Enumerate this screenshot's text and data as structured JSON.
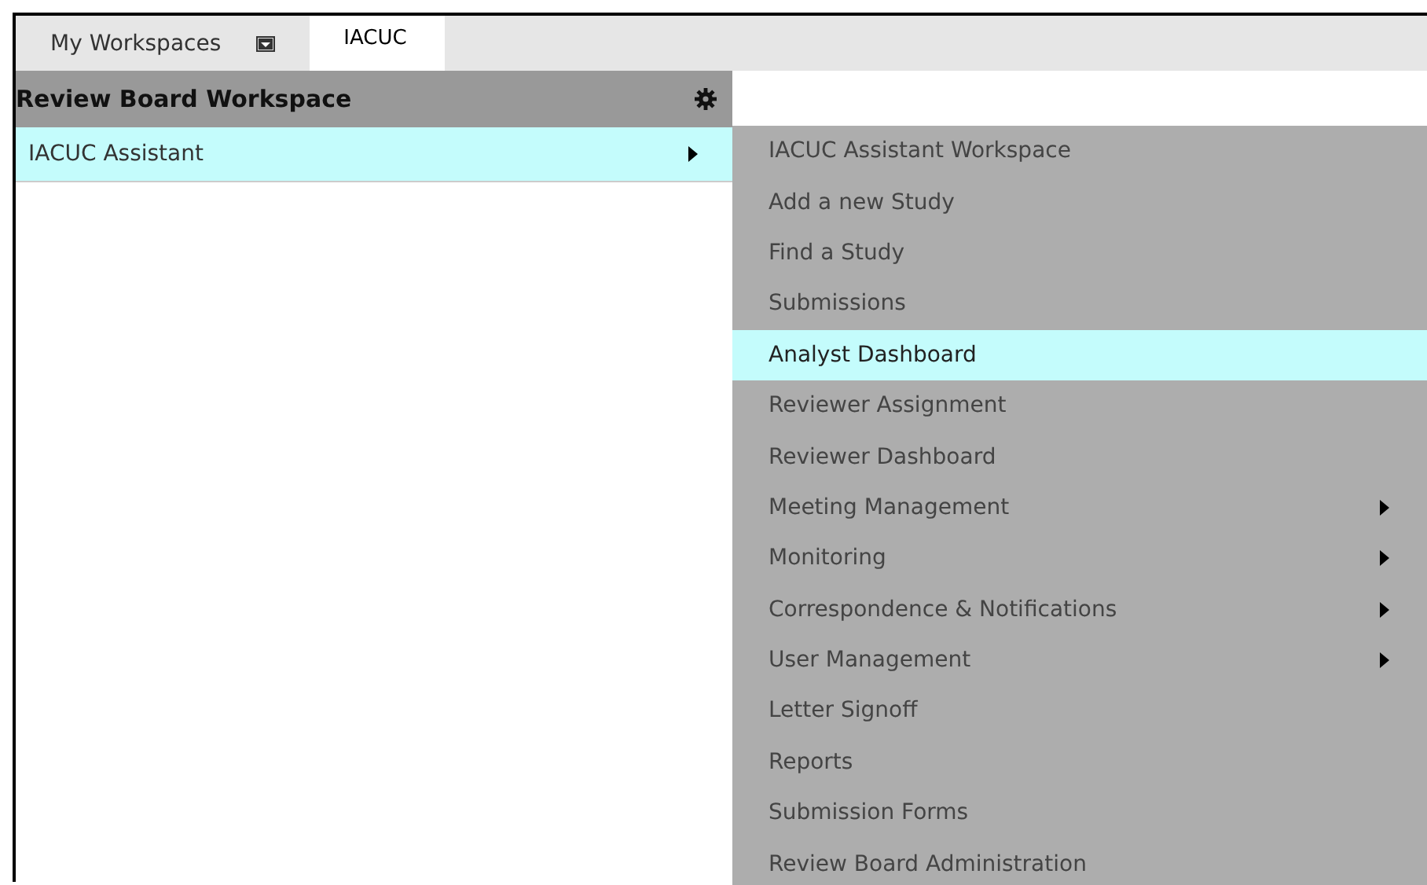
{
  "tabs": [
    {
      "label": "My Workspaces",
      "selected": false,
      "has_dropdown": true
    },
    {
      "label": "IACUC",
      "selected": true,
      "has_dropdown": false
    }
  ],
  "workspace": {
    "title": "Review Board Workspace",
    "items": [
      {
        "label": "IACUC Assistant",
        "selected": true,
        "submenu": true
      }
    ]
  },
  "submenu": {
    "items": [
      {
        "label": "IACUC Assistant Workspace",
        "selected": false,
        "submenu": false
      },
      {
        "label": "Add a new Study",
        "selected": false,
        "submenu": false
      },
      {
        "label": "Find a Study",
        "selected": false,
        "submenu": false
      },
      {
        "label": "Submissions",
        "selected": false,
        "submenu": false
      },
      {
        "label": "Analyst Dashboard",
        "selected": true,
        "submenu": false
      },
      {
        "label": "Reviewer Assignment",
        "selected": false,
        "submenu": false
      },
      {
        "label": "Reviewer Dashboard",
        "selected": false,
        "submenu": false
      },
      {
        "label": "Meeting Management",
        "selected": false,
        "submenu": true
      },
      {
        "label": "Monitoring",
        "selected": false,
        "submenu": true
      },
      {
        "label": "Correspondence & Notifications",
        "selected": false,
        "submenu": true
      },
      {
        "label": "User Management",
        "selected": false,
        "submenu": true
      },
      {
        "label": "Letter Signoff",
        "selected": false,
        "submenu": false
      },
      {
        "label": "Reports",
        "selected": false,
        "submenu": false
      },
      {
        "label": "Submission Forms",
        "selected": false,
        "submenu": false
      },
      {
        "label": "Review Board Administration",
        "selected": false,
        "submenu": false
      }
    ]
  }
}
